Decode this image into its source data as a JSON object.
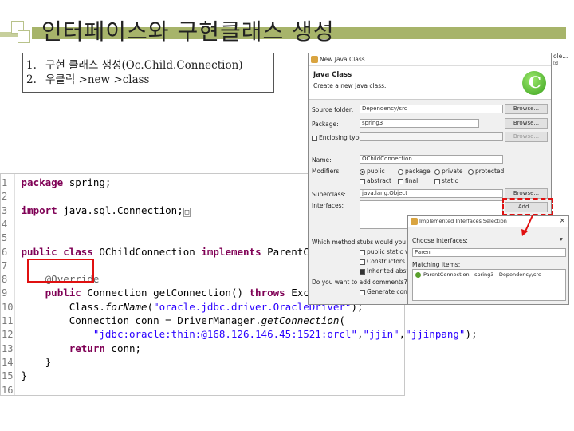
{
  "slide": {
    "title": "인터페이스와 구현클래스 생성",
    "steps": [
      {
        "num": "1.",
        "text": "구현 클래스 생성(Oc.Child.Connection)"
      },
      {
        "num": "2.",
        "text": "우클릭 >new >class"
      }
    ]
  },
  "code": {
    "lines": [
      {
        "n": "1",
        "html": "<span class=\"kw\">package</span> spring;"
      },
      {
        "n": "2",
        "html": ""
      },
      {
        "n": "3",
        "html": "<span class=\"kw\">import</span> java.sql.Connection;<span class=\"collapsed\">□</span>"
      },
      {
        "n": "4",
        "html": ""
      },
      {
        "n": "5",
        "html": ""
      },
      {
        "n": "6",
        "html": "<span class=\"kw\">public</span> <span class=\"kw\">class</span> OChild<span>Connection</span> <span class=\"kw\">implements</span> ParentConnection {"
      },
      {
        "n": "7",
        "html": ""
      },
      {
        "n": "8",
        "html": "    <span class=\"ann\">@Override</span>"
      },
      {
        "n": "9",
        "html": "    <span class=\"kw\">public</span> Connection getConnection() <span class=\"kw\">throws</span> Exception {"
      },
      {
        "n": "10",
        "html": "        Class.<span class=\"it\">forName</span>(<span class=\"str\">\"oracle.jdbc.driver.OracleDriver\"</span>);"
      },
      {
        "n": "11",
        "html": "        Connection conn = DriverManager.<span class=\"it\">getConnection</span>("
      },
      {
        "n": "12",
        "html": "            <span class=\"str\">\"jdbc:oracle:thin:@168.126.146.45:1521:orcl\"</span>,<span class=\"str\">\"jjin\"</span>,<span class=\"str\">\"jjinpang\"</span>);"
      },
      {
        "n": "13",
        "html": "        <span class=\"kw\">return</span> conn;"
      },
      {
        "n": "14",
        "html": "    }"
      },
      {
        "n": "15",
        "html": "}"
      },
      {
        "n": "16",
        "html": ""
      }
    ]
  },
  "dialog": {
    "title": "New Java Class",
    "header_title": "Java Class",
    "header_desc": "Create a new Java class.",
    "source_folder_label": "Source folder:",
    "source_folder_value": "Dependency/src",
    "package_label": "Package:",
    "package_value": "spring3",
    "enclosing_label": "Enclosing type:",
    "name_label": "Name:",
    "name_value": "OChildConnection",
    "modifiers_label": "Modifiers:",
    "mod_public": "public",
    "mod_package": "package",
    "mod_private": "private",
    "mod_protected": "protected",
    "mod_abstract": "abstract",
    "mod_final": "final",
    "mod_static": "static",
    "superclass_label": "Superclass:",
    "superclass_value": "java.lang.Object",
    "interfaces_label": "Interfaces:",
    "browse": "Browse...",
    "add": "Add...",
    "stubs_q": "Which method stubs would you like to create?",
    "stub1": "public static void main",
    "stub2": "Constructors from superclass",
    "stub3": "Inherited abstract methods",
    "comments_q": "Do you want to add comments?",
    "generate_comments": "Generate comments"
  },
  "edge_text": "ole... ☒",
  "dialog2": {
    "title": "Implemented Interfaces Selection",
    "choose_label": "Choose interfaces:",
    "filter_value": "Paren",
    "matching_label": "Matching items:",
    "match_item": "ParentConnection - spring3 - Dependency/src"
  }
}
